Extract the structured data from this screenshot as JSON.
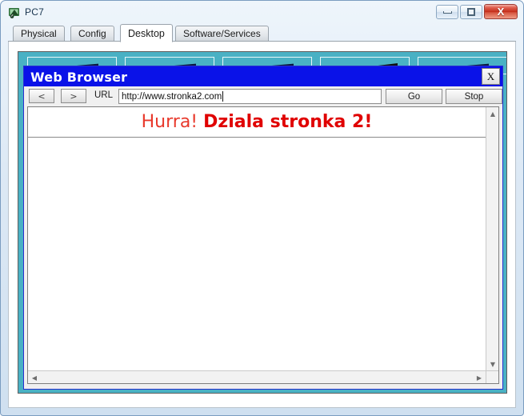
{
  "window": {
    "title": "PC7",
    "icon": "packet-tracer-device-icon",
    "controls": {
      "minimize": "minimize-icon",
      "maximize": "maximize-icon",
      "close": "X"
    }
  },
  "tabs": [
    {
      "label": "Physical",
      "active": false
    },
    {
      "label": "Config",
      "active": false
    },
    {
      "label": "Desktop",
      "active": true
    },
    {
      "label": "Software/Services",
      "active": false
    }
  ],
  "desktop": {
    "background_color": "#49b1c4",
    "icons": [
      {
        "name": "desktop-icon-1"
      },
      {
        "name": "desktop-icon-2"
      },
      {
        "name": "desktop-icon-3"
      },
      {
        "name": "desktop-icon-4"
      },
      {
        "name": "desktop-icon-5"
      }
    ]
  },
  "browser": {
    "title": "Web Browser",
    "title_bar_color": "#0a12e8",
    "close_label": "X",
    "nav": {
      "back_label": "<",
      "forward_label": ">"
    },
    "url_label": "URL",
    "url_value": "http://www.stronka2.com",
    "url_placeholder": "http://",
    "go_label": "Go",
    "stop_label": "Stop",
    "page": {
      "heading_plain": "Hurra!",
      "heading_bold": "Dziala stronka 2!",
      "plain_color": "#e8392c",
      "bold_color": "#e00000",
      "has_rule": true
    },
    "scrollbars": {
      "v_up": "▲",
      "v_down": "▼",
      "h_left": "◀",
      "h_right": "▶"
    }
  }
}
